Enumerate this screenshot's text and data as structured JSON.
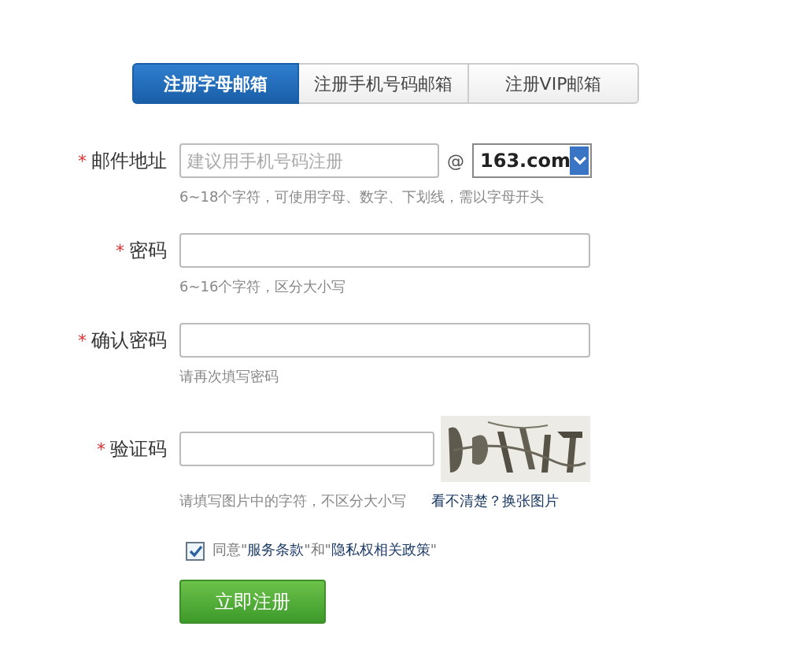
{
  "tabs": [
    {
      "label": "注册字母邮箱",
      "selected": true
    },
    {
      "label": "注册手机号码邮箱",
      "selected": false
    },
    {
      "label": "注册VIP邮箱",
      "selected": false
    }
  ],
  "email": {
    "required_mark": "*",
    "label": "邮件地址",
    "placeholder": "建议用手机号码注册",
    "at": "@",
    "domain": "163.com",
    "hint": "6~18个字符，可使用字母、数字、下划线，需以字母开头"
  },
  "password": {
    "required_mark": "*",
    "label": "密码",
    "hint": "6~16个字符，区分大小写"
  },
  "confirm_password": {
    "required_mark": "*",
    "label": "确认密码",
    "hint": "请再次填写密码"
  },
  "captcha": {
    "required_mark": "*",
    "label": "验证码",
    "hint": "请填写图片中的字符，不区分大小写",
    "refresh_link": "看不清楚？换张图片"
  },
  "agreement": {
    "checked": true,
    "text": "同意\"**服务条款**\"和\"**隐私权相关政策**\""
  },
  "submit_button": "立即注册"
}
